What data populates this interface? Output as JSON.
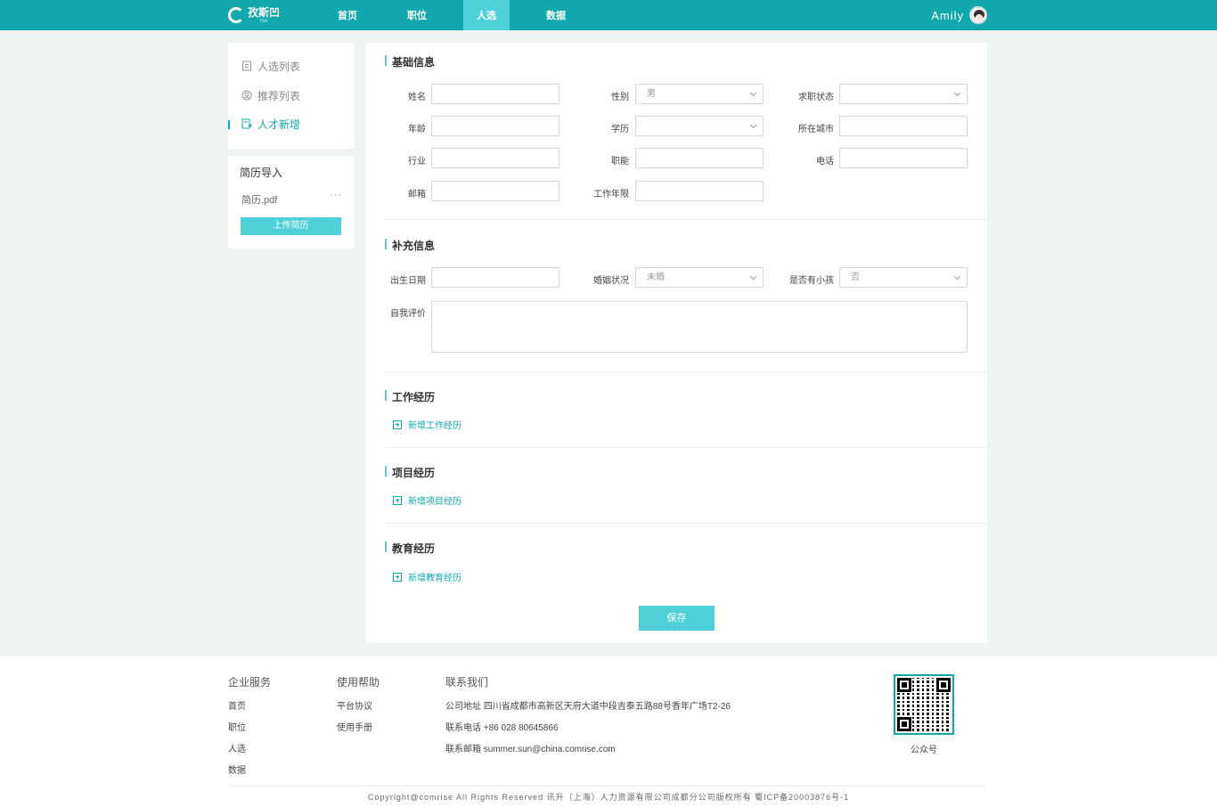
{
  "header": {
    "logo_text": "孜斯凹",
    "logo_sub": "Tom",
    "nav": [
      {
        "label": "首页"
      },
      {
        "label": "职位"
      },
      {
        "label": "人选"
      },
      {
        "label": "数据"
      }
    ],
    "active_nav": "人选",
    "user_name": "Amily",
    "brand_color": "#10a8ad",
    "accent_color": "#4dd0d7"
  },
  "sidebar": {
    "items": [
      {
        "label": "人选列表",
        "icon": "list-icon"
      },
      {
        "label": "推荐列表",
        "icon": "user-circle-icon"
      },
      {
        "label": "人才新增",
        "icon": "add-user-icon"
      }
    ],
    "active_item": "人才新增"
  },
  "resume": {
    "title": "简历导入",
    "file_name": "简历.pdf",
    "more": "···",
    "upload_label": "上传简历"
  },
  "basic": {
    "title": "基础信息",
    "name_label": "姓名",
    "gender_label": "性别",
    "gender_value": "男",
    "status_label": "求职状态",
    "age_label": "年龄",
    "education_label": "学历",
    "city_label": "所在城市",
    "industry_label": "行业",
    "function_label": "职能",
    "phone_label": "电话",
    "email_label": "邮箱",
    "years_label": "工作年限"
  },
  "extra": {
    "title": "补充信息",
    "birth_label": "出生日期",
    "marital_label": "婚姻状况",
    "marital_value": "未婚",
    "children_label": "是否有小孩",
    "children_value": "否",
    "self_eval_label": "自我评价"
  },
  "work": {
    "title": "工作经历",
    "add_label": "新增工作经历"
  },
  "project": {
    "title": "项目经历",
    "add_label": "新增项目经历"
  },
  "education": {
    "title": "教育经历",
    "add_label": "新增教育经历"
  },
  "save_label": "保存",
  "footer": {
    "col1": {
      "title": "企业服务",
      "items": [
        "首页",
        "职位",
        "人选",
        "数据"
      ]
    },
    "col2": {
      "title": "使用帮助",
      "items": [
        "平台协议",
        "使用手册"
      ]
    },
    "col3": {
      "title": "联系我们",
      "address": "公司地址 四川省成都市高新区天府大道中段吉泰五路88号香年广场T2-26",
      "phone": "联系电话 +86 028 80645866",
      "email": "联系邮箱 summer.sun@china.comrise.com"
    },
    "qr_label": "公众号",
    "copyright": "Copyright@comrise All Rights Reserved 讯升（上海）人力资源有限公司成都分公司版权所有 蜀ICP备20003876号-1"
  }
}
